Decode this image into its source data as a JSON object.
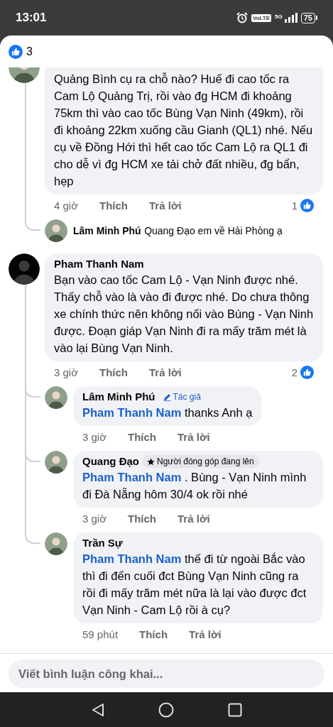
{
  "status_bar": {
    "time": "13:01",
    "volte": "VoLTE",
    "network": "5G",
    "battery": "75"
  },
  "reactions": {
    "count": "3"
  },
  "comments": [
    {
      "text": "Quảng Bình cụ ra chỗ nào? Huế đi cao tốc ra Cam Lộ Quảng Trị, rồi vào đg HCM đi khoảng 75km thì vào cao tốc Bùng Vạn Ninh (49km), rồi đi khoảng 22km xuống cầu Gianh (QL1) nhé. Nếu cụ về Đồng Hới thì hết cao tốc Cam Lộ ra QL1 đi cho dễ vì đg HCM xe tải chở đất nhiều, đg bẩn, hẹp",
      "time": "4 giờ",
      "like_label": "Thích",
      "reply_label": "Trả lời",
      "reaction_count": "1",
      "replies": [
        {
          "kind": "collapsed",
          "author": "Lâm Minh Phú",
          "text": "Quang Đạo em về Hải Phòng ạ"
        }
      ]
    },
    {
      "author": "Pham Thanh Nam",
      "text": "Bạn vào cao tốc Cam Lộ - Vạn Ninh được nhé. Thấy chỗ vào là vào đi được nhé. Do chưa thông xe chính thức nên không nối vào Bùng - Vạn Ninh được. Đoạn giáp Vạn Ninh đi ra mấy trăm mét là vào lại Bùng Vạn Ninh.",
      "time": "3 giờ",
      "like_label": "Thích",
      "reply_label": "Trả lời",
      "reaction_count": "2",
      "replies": [
        {
          "kind": "bubble",
          "author": "Lâm Minh Phú",
          "badge": {
            "kind": "author",
            "label": "Tác giả"
          },
          "mention": "Pham Thanh Nam",
          "text": "thanks Anh ạ",
          "time": "3 giờ",
          "like_label": "Thích",
          "reply_label": "Trả lời"
        },
        {
          "kind": "bubble",
          "author": "Quang Đạo",
          "badge": {
            "kind": "rising",
            "label": "Người đóng góp đang lên"
          },
          "mention": "Pham Thanh Nam",
          "text": ". Bùng - Vạn Ninh mình đi Đà Nẵng hôm 30/4 ok rồi nhé",
          "time": "3 giờ",
          "like_label": "Thích",
          "reply_label": "Trả lời"
        },
        {
          "kind": "bubble",
          "author": "Trần Sự",
          "mention": "Pham Thanh Nam",
          "text": "thế đi từ ngoài Bắc vào thì đi đến cuối đct Bùng Vạn Ninh cũng ra rồi đi mấy trăm mét nữa là lại vào được đct Vạn Ninh - Cam Lộ rồi à cụ?",
          "time": "59 phút",
          "like_label": "Thích",
          "reply_label": "Trả lời"
        }
      ]
    }
  ],
  "composer": {
    "placeholder": "Viết bình luận công khai..."
  }
}
